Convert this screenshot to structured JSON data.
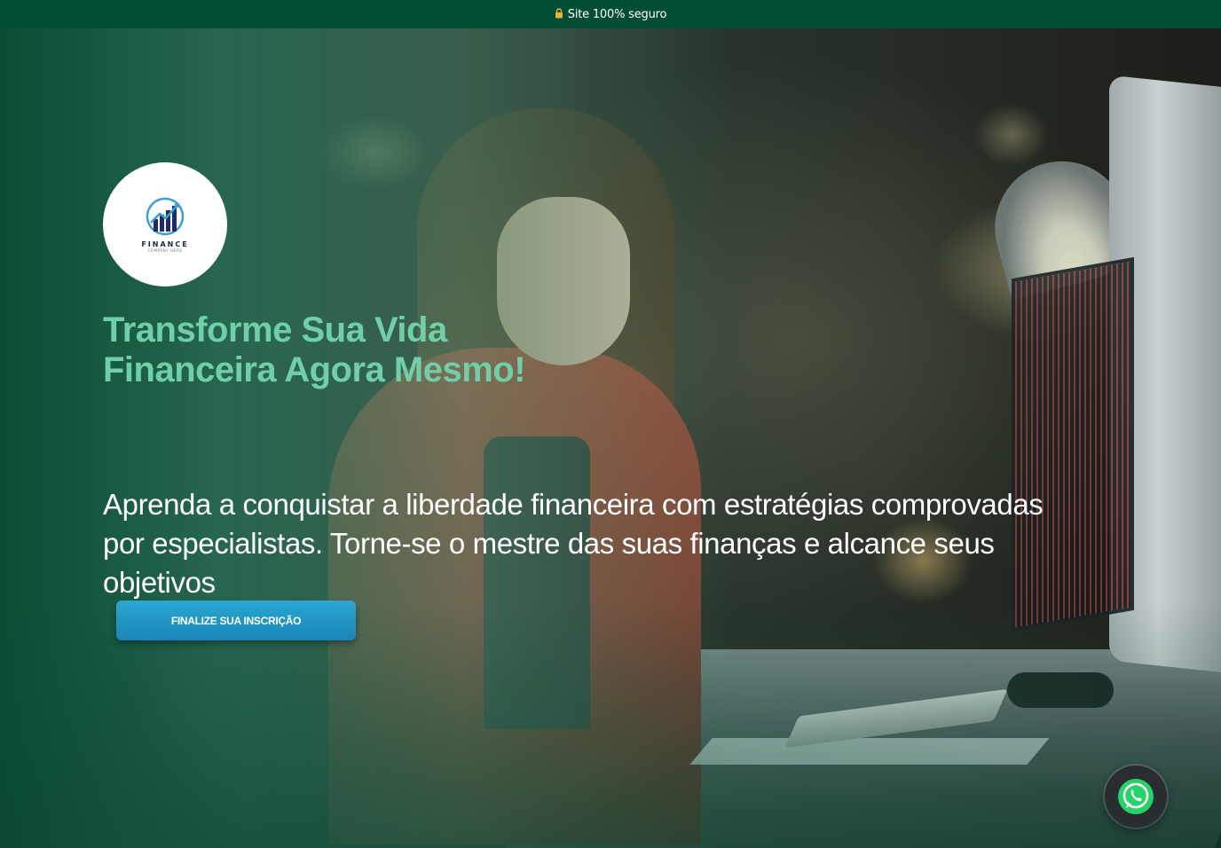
{
  "topbar": {
    "text": "Site 100% seguro",
    "icon": "lock-icon"
  },
  "logo": {
    "brand": "FINANCE",
    "tagline": "COMPANY HERE"
  },
  "hero": {
    "headline": "Transforme Sua Vida Financeira Agora Mesmo!",
    "subheadline": "Aprenda a conquistar a liberdade financeira com estratégias comprovadas por especialistas. Torne-se o mestre das suas finanças e alcance seus objetivos",
    "cta_label": "FINALIZE SUA INSCRIÇÃO"
  },
  "floating": {
    "icon": "whatsapp-icon"
  },
  "colors": {
    "topbar_bg": "#034d34",
    "headline": "#6fd0a8",
    "cta_bg": "#1f97c6",
    "whatsapp": "#25d366"
  }
}
